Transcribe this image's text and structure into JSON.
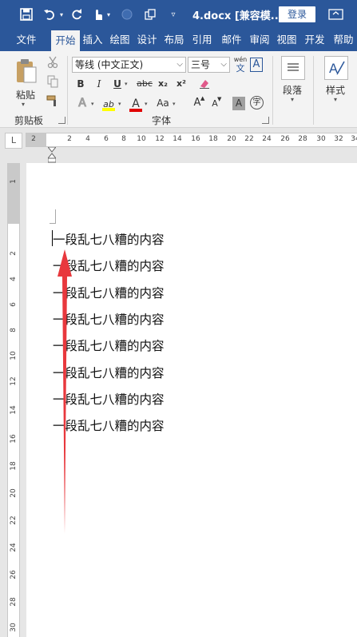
{
  "titlebar": {
    "title": "4.docx [兼容模...",
    "login_label": "登录",
    "save_icon": "save-icon",
    "undo_icon": "undo-icon",
    "redo_icon": "redo-icon",
    "touch_icon": "touch-mode-icon",
    "customize_icon": "customize-qat-icon"
  },
  "tabs": [
    {
      "label": "文件"
    },
    {
      "label": "开始"
    },
    {
      "label": "插入"
    },
    {
      "label": "绘图"
    },
    {
      "label": "设计"
    },
    {
      "label": "布局"
    },
    {
      "label": "引用"
    },
    {
      "label": "邮件"
    },
    {
      "label": "审阅"
    },
    {
      "label": "视图"
    },
    {
      "label": "开发"
    },
    {
      "label": "帮助"
    }
  ],
  "ribbon": {
    "clipboard": {
      "paste_label": "粘贴",
      "group_label": "剪贴板"
    },
    "font": {
      "font_name": "等线 (中文正文)",
      "font_size": "三号",
      "pinyin_label": "wén",
      "pinyin_sub": "文",
      "border_char": "A",
      "bold": "B",
      "italic": "I",
      "underline": "U",
      "strike": "abc",
      "subscript": "x₂",
      "superscript": "x²",
      "text_effect": "A",
      "highlight": "ab",
      "font_color": "A",
      "change_case": "Aa",
      "grow": "A",
      "shrink": "A",
      "shade": "A",
      "enclose": "字",
      "group_label": "字体"
    },
    "paragraph": {
      "label": "段落"
    },
    "styles": {
      "label": "样式"
    }
  },
  "ruler": {
    "corner": "L",
    "h_ticks": [
      "2",
      "2",
      "4",
      "6",
      "8",
      "10",
      "12",
      "14",
      "16",
      "18",
      "20",
      "22",
      "24",
      "26",
      "28",
      "30",
      "32",
      "34"
    ],
    "v_ticks": [
      "1",
      "2",
      "4",
      "6",
      "8",
      "10",
      "12",
      "14",
      "16",
      "18",
      "20",
      "22",
      "24",
      "26",
      "28",
      "30"
    ]
  },
  "document": {
    "lines": [
      "一段乱七八糟的内容",
      "一段乱七八糟的内容",
      "一段乱七八糟的内容",
      "一段乱七八糟的内容",
      "一段乱七八糟的内容",
      "一段乱七八糟的内容",
      "一段乱七八糟的内容",
      "一段乱七八糟的内容"
    ]
  },
  "colors": {
    "title_blue": "#2b579a",
    "ribbon_bg": "#f3f3f3",
    "arrow_red": "#e8383d",
    "highlight_yellow": "#ffff00",
    "font_red": "#e00000"
  }
}
